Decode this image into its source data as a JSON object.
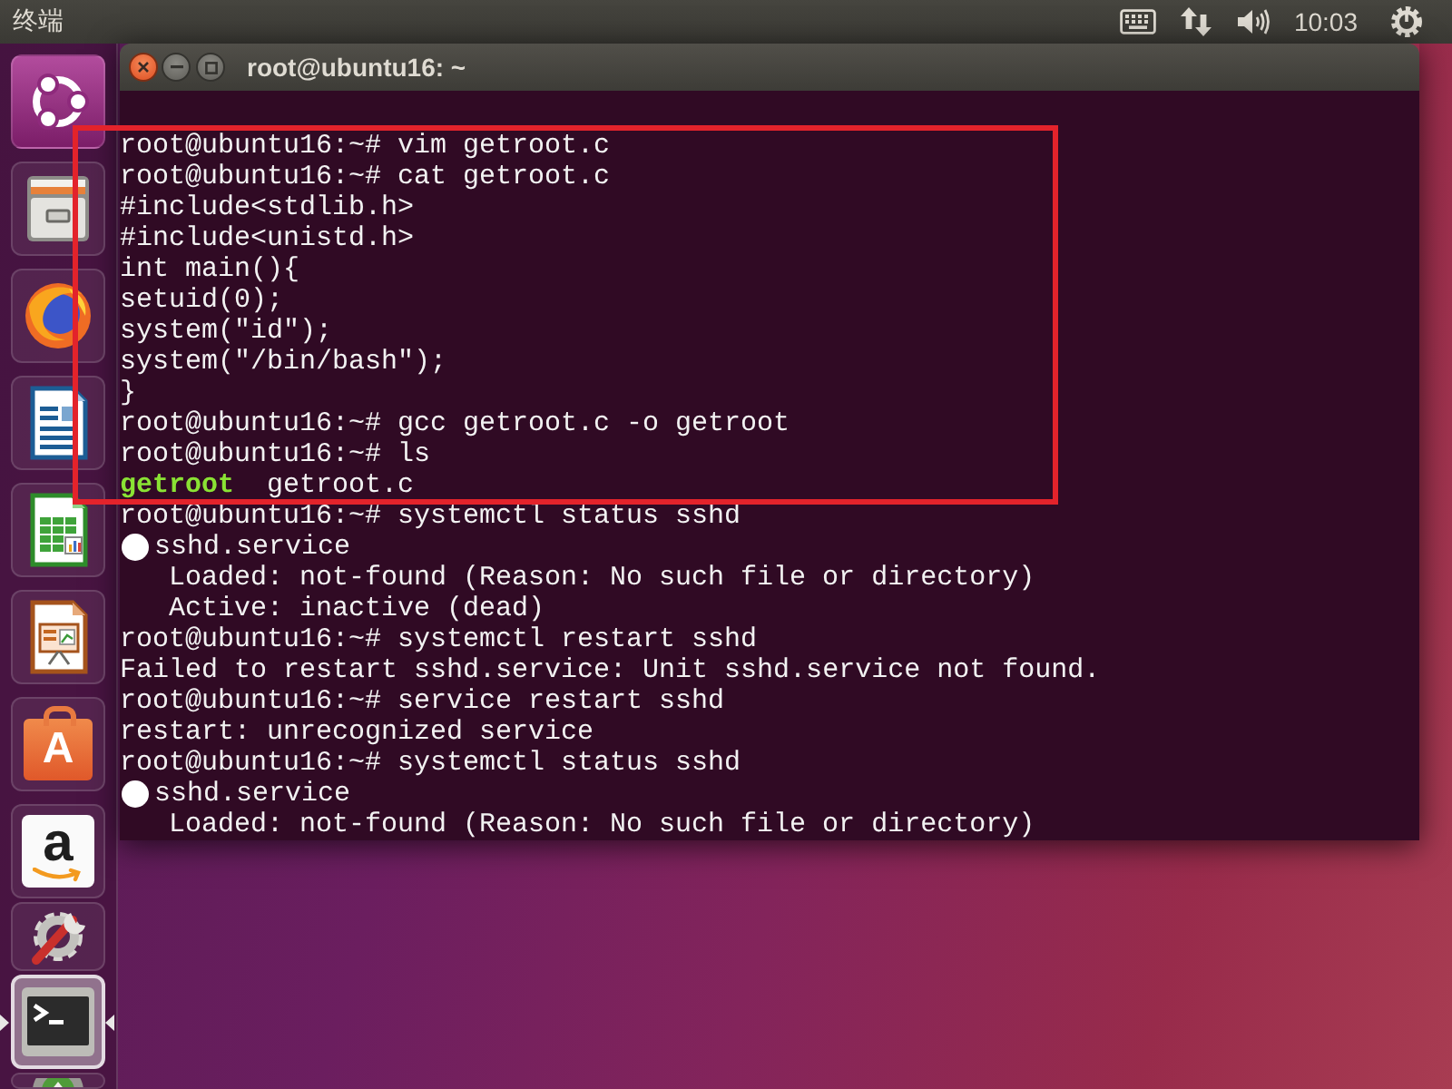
{
  "top_panel": {
    "app_name": "终端",
    "time": "10:03"
  },
  "launcher": {
    "items": [
      {
        "kind": "dash",
        "selected": false
      },
      {
        "kind": "files",
        "selected": false
      },
      {
        "kind": "browser",
        "selected": false
      },
      {
        "kind": "writer",
        "selected": false
      },
      {
        "kind": "calc",
        "selected": false
      },
      {
        "kind": "impress",
        "selected": false
      },
      {
        "kind": "software",
        "glyph": "A",
        "selected": false
      },
      {
        "kind": "amazon",
        "glyph": "a",
        "selected": false
      },
      {
        "kind": "settings",
        "selected": false
      },
      {
        "kind": "terminal",
        "selected": true
      },
      {
        "kind": "updater",
        "selected": false
      }
    ]
  },
  "window": {
    "title": "root@ubuntu16: ~",
    "sections": [
      {
        "highlighted": true,
        "lines": [
          {
            "kind": "command",
            "text": "root@ubuntu16:~# vim getroot.c"
          },
          {
            "kind": "command",
            "text": "root@ubuntu16:~# cat getroot.c"
          },
          {
            "kind": "output",
            "text": "#include<stdlib.h>"
          },
          {
            "kind": "output",
            "text": "#include<unistd.h>"
          },
          {
            "kind": "output",
            "text": "int main(){"
          },
          {
            "kind": "output",
            "text": "setuid(0);"
          },
          {
            "kind": "output",
            "text": "system(\"id\");"
          },
          {
            "kind": "output",
            "text": "system(\"/bin/bash\");"
          },
          {
            "kind": "output",
            "text": "}"
          },
          {
            "kind": "command",
            "text": "root@ubuntu16:~# gcc getroot.c -o getroot"
          },
          {
            "kind": "command",
            "text": "root@ubuntu16:~# ls"
          },
          {
            "kind": "listing",
            "entries": [
              {
                "name": "getroot",
                "kind": "executable"
              },
              {
                "name": "getroot.c",
                "kind": "file"
              }
            ]
          }
        ]
      },
      {
        "highlighted": false,
        "lines": [
          {
            "kind": "command",
            "text": "root@ubuntu16:~# systemctl status sshd"
          },
          {
            "kind": "unit",
            "text": "sshd.service"
          },
          {
            "kind": "detail",
            "text": "Loaded: not-found (Reason: No such file or directory)"
          },
          {
            "kind": "detail",
            "text": "Active: inactive (dead)"
          },
          {
            "kind": "command",
            "text": "root@ubuntu16:~# systemctl restart sshd"
          },
          {
            "kind": "output",
            "text": "Failed to restart sshd.service: Unit sshd.service not found."
          },
          {
            "kind": "command",
            "text": "root@ubuntu16:~# service restart sshd"
          },
          {
            "kind": "output",
            "text": "restart: unrecognized service"
          },
          {
            "kind": "command",
            "text": "root@ubuntu16:~# systemctl status sshd"
          },
          {
            "kind": "unit",
            "text": "sshd.service"
          },
          {
            "kind": "detail",
            "text": "Loaded: not-found (Reason: No such file or directory)"
          }
        ]
      }
    ]
  }
}
